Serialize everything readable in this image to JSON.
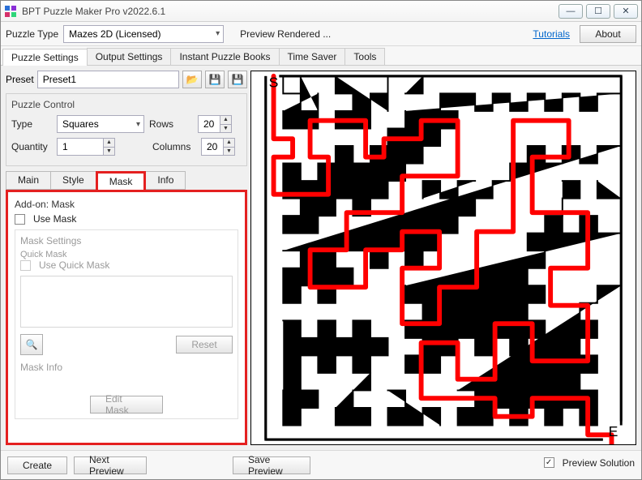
{
  "window": {
    "title": "BPT Puzzle Maker Pro v2022.6.1"
  },
  "winbuttons": {
    "min": "—",
    "max": "☐",
    "close": "✕"
  },
  "toprow": {
    "label_puzzle_type": "Puzzle Type",
    "puzzle_type_value": "Mazes 2D (Licensed)",
    "status": "Preview Rendered ...",
    "tutorials": "Tutorials",
    "about": "About"
  },
  "maintabs": [
    "Puzzle Settings",
    "Output Settings",
    "Instant Puzzle Books",
    "Time Saver",
    "Tools"
  ],
  "preset": {
    "label": "Preset",
    "value": "Preset1"
  },
  "puzzle_control": {
    "title": "Puzzle Control",
    "type_label": "Type",
    "type_value": "Squares",
    "rows_label": "Rows",
    "rows_value": "20",
    "quantity_label": "Quantity",
    "quantity_value": "1",
    "columns_label": "Columns",
    "columns_value": "20"
  },
  "subtabs": [
    "Main",
    "Style",
    "Mask",
    "Info"
  ],
  "mask_panel": {
    "title": "Add-on: Mask",
    "use_mask": "Use Mask",
    "mask_settings": "Mask Settings",
    "quick_mask": "Quick Mask",
    "use_quick_mask": "Use Quick Mask",
    "reset": "Reset",
    "mask_info": "Mask Info",
    "edit_mask": "Edit Mask"
  },
  "bottom": {
    "create": "Create",
    "next_preview": "Next Preview",
    "save_preview": "Save Preview",
    "preview_solution": "Preview Solution"
  },
  "maze": {
    "start": "S",
    "end": "E"
  }
}
